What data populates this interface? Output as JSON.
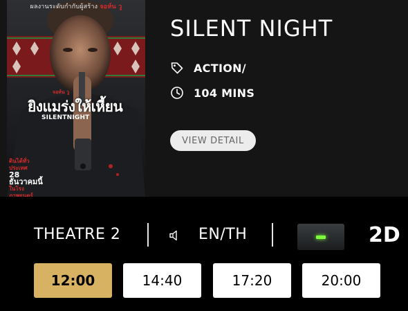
{
  "movie": {
    "title": "SILENT NIGHT",
    "genre": "ACTION/",
    "duration": "104 MINS",
    "view_detail_label": "VIEW DETAIL",
    "poster": {
      "tagline_white": "ผลงานระดับกำกับผู้สร้าง",
      "tagline_red": "จอห์น วู",
      "director_label": "จอห์น วู",
      "title_thai": "ยิงแมร่งให้เหี้ยน",
      "title_en": "SILENTNIGHT",
      "release_label": "ดินได้ทั่วประเทศ",
      "release_date": "28 ธันวาคมนี้",
      "release_sub": "ในโรงภาพยนตร์"
    }
  },
  "session": {
    "theatre": "THEATRE 2",
    "language": "EN/TH",
    "format": "2D",
    "format_icon": "screen-led-icon",
    "audio_icon": "speaker-icon"
  },
  "showtimes": [
    {
      "time": "12:00",
      "selected": true
    },
    {
      "time": "14:40",
      "selected": false
    },
    {
      "time": "17:20",
      "selected": false
    },
    {
      "time": "20:00",
      "selected": false
    }
  ],
  "colors": {
    "selected_showtime": "#d7b263",
    "panel_background": "#151515",
    "page_background": "#000000",
    "format_led": "#7cff3a"
  }
}
